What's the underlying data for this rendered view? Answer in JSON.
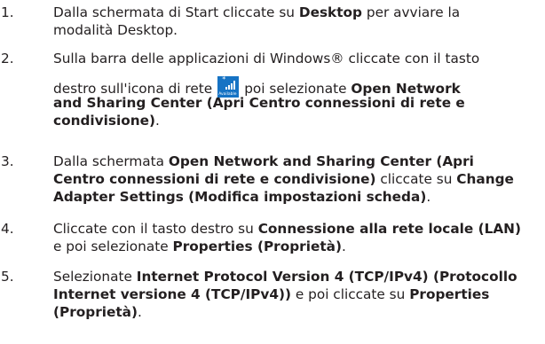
{
  "steps": [
    {
      "number": "1.",
      "lines": [
        [
          {
            "t": "Dalla schermata di Start cliccate su "
          },
          {
            "t": "Desktop",
            "b": true
          },
          {
            "t": " per avviare la"
          }
        ],
        [
          {
            "t": "modalità Desktop."
          }
        ]
      ]
    },
    {
      "number": "2.",
      "lines": [
        [
          {
            "t": "Sulla barra delle applicazioni di Windows® cliccate con il tasto"
          }
        ],
        [
          {
            "t": "destro sull'icona di rete"
          },
          {
            "icon": "network-icon"
          },
          {
            "t": "poi selezionate "
          },
          {
            "t": "Open Network",
            "b": true
          }
        ],
        [
          {
            "t": "and Sharing Center (Apri Centro connessioni di rete e",
            "b": true
          }
        ],
        [
          {
            "t": "condivisione)",
            "b": true
          },
          {
            "t": "."
          }
        ]
      ]
    },
    {
      "number": "3.",
      "lines": [
        [
          {
            "t": "Dalla schermata "
          },
          {
            "t": "Open Network and Sharing Center (Apri",
            "b": true
          }
        ],
        [
          {
            "t": "Centro connessioni di rete e condivisione)",
            "b": true
          },
          {
            "t": " cliccate su "
          },
          {
            "t": "Change",
            "b": true
          }
        ],
        [
          {
            "t": "Adapter Settings (Modifica impostazioni scheda)",
            "b": true
          },
          {
            "t": "."
          }
        ]
      ]
    },
    {
      "number": "4.",
      "lines": [
        [
          {
            "t": "Cliccate con il tasto destro su "
          },
          {
            "t": "Connessione alla rete locale (LAN)",
            "b": true
          }
        ],
        [
          {
            "t": "e poi selezionate "
          },
          {
            "t": "Properties (Proprietà)",
            "b": true
          },
          {
            "t": "."
          }
        ]
      ]
    },
    {
      "number": "5.",
      "lines": [
        [
          {
            "t": "Selezionate "
          },
          {
            "t": "Internet Protocol Version 4 (TCP/IPv4) (Protocollo",
            "b": true
          }
        ],
        [
          {
            "t": "Internet versione 4 (TCP/IPv4))",
            "b": true
          },
          {
            "t": " e poi cliccate su "
          },
          {
            "t": "Properties",
            "b": true
          }
        ],
        [
          {
            "t": "(Proprietà)",
            "b": true
          },
          {
            "t": "."
          }
        ]
      ]
    }
  ],
  "network_icon": {
    "name": "network-icon",
    "label": "Available",
    "background": "#1673c4"
  }
}
